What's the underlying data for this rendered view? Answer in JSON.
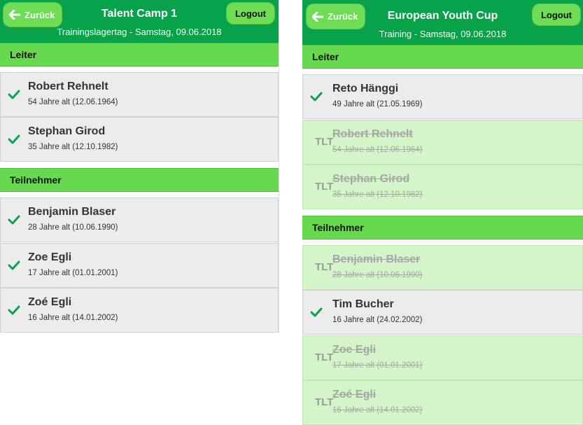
{
  "colors": {
    "header_bg": "#08a24a",
    "button_bg": "#6edc55",
    "section_bg": "#66d94f",
    "item_bg": "#ececec",
    "excluded_bg": "#d4f5c9",
    "check": "#08a24a"
  },
  "icons": {
    "back": "arrow-left-icon",
    "present": "check-icon"
  },
  "left": {
    "back_label": "Zurück",
    "logout_label": "Logout",
    "title": "Talent Camp 1",
    "subtitle": "Trainingslagertag - Samstag, 09.06.2018",
    "section_leiter": "Leiter",
    "section_teilnehmer": "Teilnehmer",
    "leiter": [
      {
        "name": "Robert Rehnelt",
        "age": "54 Jahre alt (12.06.1964)"
      },
      {
        "name": "Stephan Girod",
        "age": "35 Jahre alt (12.10.1982)"
      }
    ],
    "teilnehmer": [
      {
        "name": "Benjamin Blaser",
        "age": "28 Jahre alt (10.06.1990)"
      },
      {
        "name": "Zoe Egli",
        "age": "17 Jahre alt (01.01.2001)"
      },
      {
        "name": "Zoé Egli",
        "age": "16 Jahre alt (14.01.2002)"
      }
    ]
  },
  "right": {
    "back_label": "Zurück",
    "logout_label": "Logout",
    "title": "European Youth Cup",
    "subtitle": "Training - Samstag, 09.06.2018",
    "section_leiter": "Leiter",
    "section_teilnehmer": "Teilnehmer",
    "tlt_label": "TLT",
    "leiter": [
      {
        "name": "Reto Hänggi",
        "age": "49 Jahre alt (21.05.1969)",
        "status": "present"
      },
      {
        "name": "Robert Rehnelt",
        "age": "54 Jahre alt (12.06.1964)",
        "status": "TLT"
      },
      {
        "name": "Stephan Girod",
        "age": "35 Jahre alt (12.10.1982)",
        "status": "TLT"
      }
    ],
    "teilnehmer": [
      {
        "name": "Benjamin Blaser",
        "age": "28 Jahre alt (10.06.1990)",
        "status": "TLT"
      },
      {
        "name": "Tim Bucher",
        "age": "16 Jahre alt (24.02.2002)",
        "status": "present"
      },
      {
        "name": "Zoe Egli",
        "age": "17 Jahre alt (01.01.2001)",
        "status": "TLT"
      },
      {
        "name": "Zoé Egli",
        "age": "16 Jahre alt (14.01.2002)",
        "status": "TLT"
      }
    ]
  }
}
